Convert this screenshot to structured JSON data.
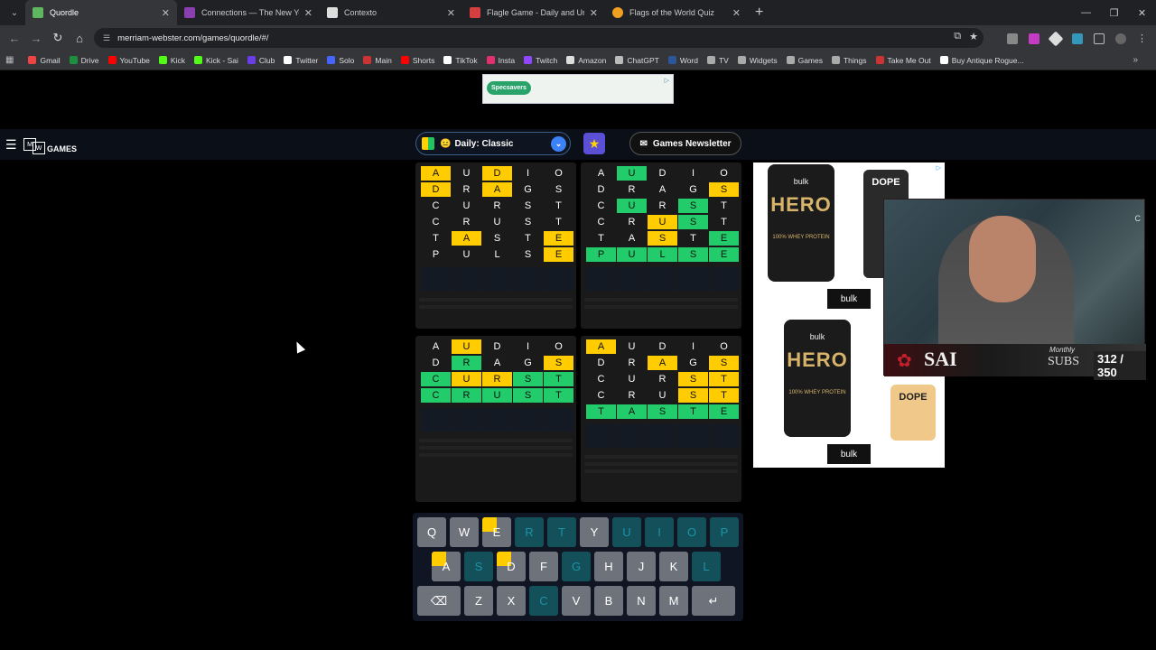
{
  "browser": {
    "tabs": [
      {
        "title": "Quordle",
        "color": "#5fb85f",
        "active": true
      },
      {
        "title": "Connections — The New York Times",
        "color": "#8a3fb0"
      },
      {
        "title": "Contexto",
        "color": "#dddddd"
      },
      {
        "title": "Flagle Game - Daily and Unlimited",
        "color": "#d63f3f"
      },
      {
        "title": "Flags of the World Quiz",
        "color": "#f0a020"
      }
    ],
    "url": "merriam-webster.com/games/quordle/#/",
    "bookmarks": [
      "Gmail",
      "Drive",
      "YouTube",
      "Kick",
      "Kick - Sai",
      "Club",
      "Twitter",
      "Solo",
      "Main",
      "Shorts",
      "TikTok",
      "Insta",
      "Twitch",
      "Amazon",
      "ChatGPT",
      "Word",
      "TV",
      "Widgets",
      "Games",
      "Things",
      "Take Me Out",
      "Buy Antique Rogue..."
    ]
  },
  "ad_top": {
    "brand": "Specsavers"
  },
  "header": {
    "logo_games": "GAMES",
    "mode": "Daily: Classic",
    "newsletter": "Games Newsletter"
  },
  "boards": [
    {
      "rows": [
        [
          [
            "A",
            "y"
          ],
          [
            "U",
            ""
          ],
          [
            "D",
            "y"
          ],
          [
            "I",
            ""
          ],
          [
            "O",
            ""
          ]
        ],
        [
          [
            "D",
            "y"
          ],
          [
            "R",
            ""
          ],
          [
            "A",
            "y"
          ],
          [
            "G",
            ""
          ],
          [
            "S",
            ""
          ]
        ],
        [
          [
            "C",
            ""
          ],
          [
            "U",
            ""
          ],
          [
            "R",
            ""
          ],
          [
            "S",
            ""
          ],
          [
            "T",
            ""
          ]
        ],
        [
          [
            "C",
            ""
          ],
          [
            "R",
            ""
          ],
          [
            "U",
            ""
          ],
          [
            "S",
            ""
          ],
          [
            "T",
            ""
          ]
        ],
        [
          [
            "T",
            ""
          ],
          [
            "A",
            "y"
          ],
          [
            "S",
            ""
          ],
          [
            "T",
            ""
          ],
          [
            "E",
            "y"
          ]
        ],
        [
          [
            "P",
            ""
          ],
          [
            "U",
            ""
          ],
          [
            "L",
            ""
          ],
          [
            "S",
            ""
          ],
          [
            "E",
            "y"
          ]
        ]
      ]
    },
    {
      "rows": [
        [
          [
            "A",
            ""
          ],
          [
            "U",
            "g"
          ],
          [
            "D",
            ""
          ],
          [
            "I",
            ""
          ],
          [
            "O",
            ""
          ]
        ],
        [
          [
            "D",
            ""
          ],
          [
            "R",
            ""
          ],
          [
            "A",
            ""
          ],
          [
            "G",
            ""
          ],
          [
            "S",
            "y"
          ]
        ],
        [
          [
            "C",
            ""
          ],
          [
            "U",
            "g"
          ],
          [
            "R",
            ""
          ],
          [
            "S",
            "g"
          ],
          [
            "T",
            ""
          ]
        ],
        [
          [
            "C",
            ""
          ],
          [
            "R",
            ""
          ],
          [
            "U",
            "y"
          ],
          [
            "S",
            "g"
          ],
          [
            "T",
            ""
          ]
        ],
        [
          [
            "T",
            ""
          ],
          [
            "A",
            ""
          ],
          [
            "S",
            "y"
          ],
          [
            "T",
            ""
          ],
          [
            "E",
            "g"
          ]
        ],
        [
          [
            "P",
            "g"
          ],
          [
            "U",
            "g"
          ],
          [
            "L",
            "g"
          ],
          [
            "S",
            "g"
          ],
          [
            "E",
            "g"
          ]
        ]
      ]
    },
    {
      "rows": [
        [
          [
            "A",
            ""
          ],
          [
            "U",
            "y"
          ],
          [
            "D",
            ""
          ],
          [
            "I",
            ""
          ],
          [
            "O",
            ""
          ]
        ],
        [
          [
            "D",
            ""
          ],
          [
            "R",
            "g"
          ],
          [
            "A",
            ""
          ],
          [
            "G",
            ""
          ],
          [
            "S",
            "y"
          ]
        ],
        [
          [
            "C",
            "g"
          ],
          [
            "U",
            "y"
          ],
          [
            "R",
            "y"
          ],
          [
            "S",
            "g"
          ],
          [
            "T",
            "g"
          ]
        ],
        [
          [
            "C",
            "g"
          ],
          [
            "R",
            "g"
          ],
          [
            "U",
            "g"
          ],
          [
            "S",
            "g"
          ],
          [
            "T",
            "g"
          ]
        ]
      ]
    },
    {
      "rows": [
        [
          [
            "A",
            "y"
          ],
          [
            "U",
            ""
          ],
          [
            "D",
            ""
          ],
          [
            "I",
            ""
          ],
          [
            "O",
            ""
          ]
        ],
        [
          [
            "D",
            ""
          ],
          [
            "R",
            ""
          ],
          [
            "A",
            "y"
          ],
          [
            "G",
            ""
          ],
          [
            "S",
            "y"
          ]
        ],
        [
          [
            "C",
            ""
          ],
          [
            "U",
            ""
          ],
          [
            "R",
            ""
          ],
          [
            "S",
            "y"
          ],
          [
            "T",
            "y"
          ]
        ],
        [
          [
            "C",
            ""
          ],
          [
            "R",
            ""
          ],
          [
            "U",
            ""
          ],
          [
            "S",
            "y"
          ],
          [
            "T",
            "y"
          ]
        ],
        [
          [
            "T",
            "g"
          ],
          [
            "A",
            "g"
          ],
          [
            "S",
            "g"
          ],
          [
            "T",
            "g"
          ],
          [
            "E",
            "g"
          ]
        ]
      ]
    }
  ],
  "ad_right": {
    "brand1": "bulk",
    "product1": "HERO",
    "sub1": "100% WHEY PROTEIN",
    "product2": "DOPE",
    "cta": "bulk"
  },
  "webcam": {
    "name": "SAI",
    "monthly": "Monthly",
    "subs": "SUBS",
    "count": "312 / 350",
    "side": "C"
  },
  "keyboard": {
    "row1": [
      [
        "Q",
        ""
      ],
      [
        "W",
        ""
      ],
      [
        "E",
        "ty"
      ],
      [
        "R",
        "used"
      ],
      [
        "T",
        "used"
      ],
      [
        "Y",
        ""
      ],
      [
        "U",
        "used"
      ],
      [
        "I",
        "used"
      ],
      [
        "O",
        "used"
      ],
      [
        "P",
        "used"
      ]
    ],
    "row2": [
      [
        "A",
        "ty"
      ],
      [
        "S",
        "used"
      ],
      [
        "D",
        "ty"
      ],
      [
        "F",
        ""
      ],
      [
        "G",
        "used"
      ],
      [
        "H",
        ""
      ],
      [
        "J",
        ""
      ],
      [
        "K",
        ""
      ],
      [
        "L",
        "used"
      ]
    ],
    "row3": [
      [
        "⌫",
        "wide"
      ],
      [
        "Z",
        ""
      ],
      [
        "X",
        ""
      ],
      [
        "C",
        "used"
      ],
      [
        "V",
        ""
      ],
      [
        "B",
        ""
      ],
      [
        "N",
        ""
      ],
      [
        "M",
        ""
      ],
      [
        "↵",
        "wide"
      ]
    ]
  }
}
